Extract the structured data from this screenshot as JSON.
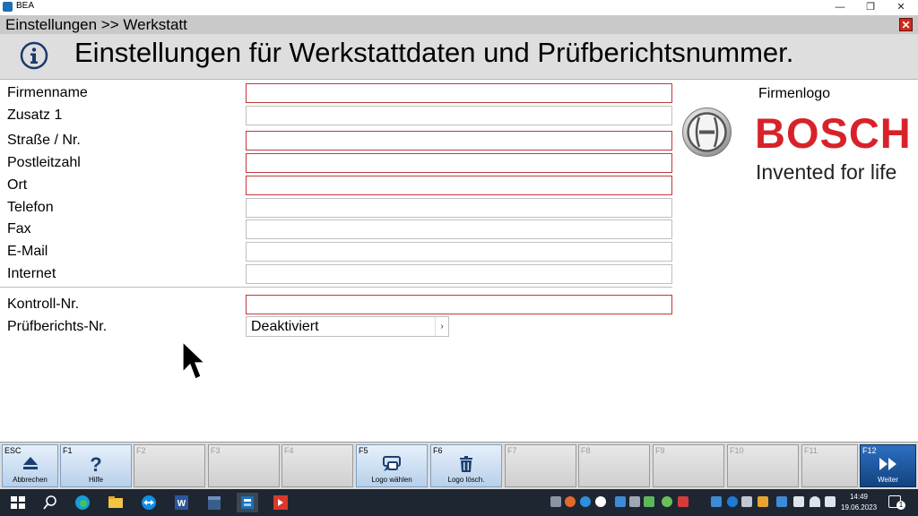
{
  "window": {
    "app_title": "BEA",
    "minimize": "—",
    "restore": "❐",
    "close": "✕"
  },
  "breadcrumb": "Einstellungen >> Werkstatt",
  "header": {
    "title": "Einstellungen für Werkstattdaten und Prüfberichtsnummer.",
    "icon": "info-icon"
  },
  "form": {
    "firmenname": {
      "label": "Firmenname",
      "value": ""
    },
    "zusatz1": {
      "label": "Zusatz 1",
      "value": ""
    },
    "strasse": {
      "label": "Straße / Nr.",
      "value": ""
    },
    "plz": {
      "label": "Postleitzahl",
      "value": ""
    },
    "ort": {
      "label": "Ort",
      "value": ""
    },
    "telefon": {
      "label": "Telefon",
      "value": ""
    },
    "fax": {
      "label": "Fax",
      "value": ""
    },
    "email": {
      "label": "E-Mail",
      "value": ""
    },
    "internet": {
      "label": "Internet",
      "value": ""
    },
    "kontroll": {
      "label": "Kontroll-Nr.",
      "value": ""
    },
    "pruefbericht": {
      "label": "Prüfberichts-Nr.",
      "value": "Deaktiviert"
    }
  },
  "logo": {
    "label": "Firmenlogo",
    "brand": "BOSCH",
    "tagline": "Invented for life",
    "brand_color": "#d8222a"
  },
  "fkeys": [
    {
      "key": "ESC",
      "label": "Abbrechen",
      "icon": "eject-icon"
    },
    {
      "key": "F1",
      "label": "Hilfe",
      "icon": "help-icon"
    },
    {
      "key": "F2",
      "label": ""
    },
    {
      "key": "F3",
      "label": ""
    },
    {
      "key": "F4",
      "label": ""
    },
    {
      "key": "F5",
      "label": "Logo wählen",
      "icon": "choose-logo-icon"
    },
    {
      "key": "F6",
      "label": "Logo lösch.",
      "icon": "trash-icon"
    },
    {
      "key": "F7",
      "label": ""
    },
    {
      "key": "F8",
      "label": ""
    },
    {
      "key": "F9",
      "label": ""
    },
    {
      "key": "F10",
      "label": ""
    },
    {
      "key": "F11",
      "label": ""
    },
    {
      "key": "F12",
      "label": "Weiter",
      "icon": "forward-icon"
    }
  ],
  "taskbar": {
    "time": "14:49",
    "date": "19.06.2023",
    "notifications": "1"
  }
}
